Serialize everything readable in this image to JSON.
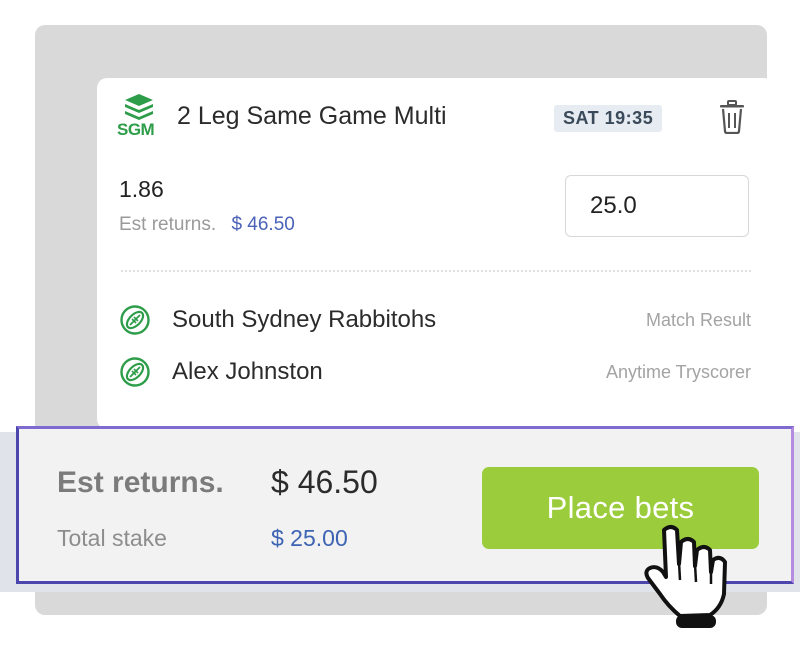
{
  "bet": {
    "logo_text": "SGM",
    "title": "2 Leg Same Game Multi",
    "time": "SAT 19:35",
    "odds": "1.86",
    "est_returns_label": "Est returns.",
    "est_returns_value": "$ 46.50",
    "stake_value": "25.0",
    "legs": [
      {
        "name": "South Sydney Rabbitohs",
        "market": "Match Result",
        "icon": "rugby-ball-icon"
      },
      {
        "name": "Alex Johnston",
        "market": "Anytime Tryscorer",
        "icon": "rugby-ball-icon"
      }
    ]
  },
  "footer": {
    "est_returns_label": "Est returns.",
    "est_returns_value": "$ 46.50",
    "total_stake_label": "Total stake",
    "total_stake_value": "$ 25.00",
    "place_bets_label": "Place bets"
  },
  "colors": {
    "brand_green": "#2e9d4a",
    "button_green": "#9bcc3c",
    "link_blue": "#4a62b8",
    "highlight_border": "#4b46ad"
  },
  "icons": [
    "sgm-logo-icon",
    "trash-icon",
    "rugby-ball-icon",
    "hand-pointer-icon"
  ]
}
